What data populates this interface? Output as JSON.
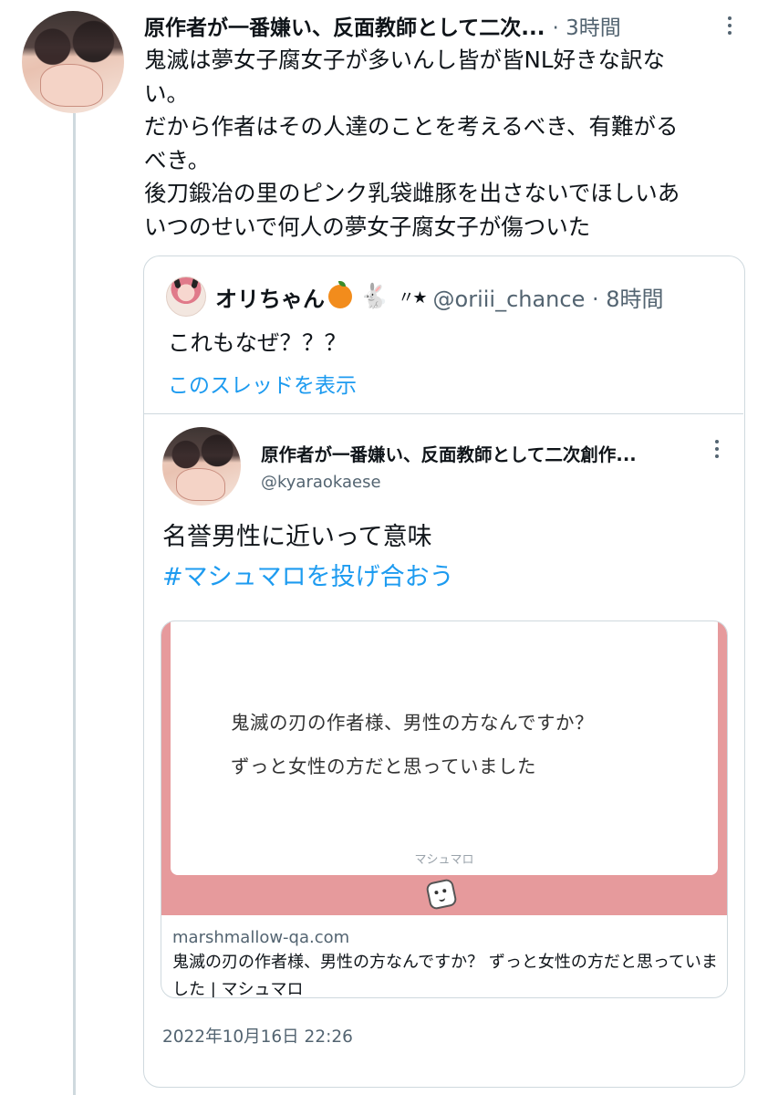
{
  "thread": {
    "author_name": "原作者が一番嫌い、反面教師として二次...",
    "time": "· 3時間",
    "body": "鬼滅は夢女子腐女子が多いんし皆が皆NL好きな訳な\nい。\nだから作者はその人達のことを考えるべき、有難がる\nべき。\n後刀鍛冶の里のピンク乳袋雌豚を出さないでほしいあ\nいつのせいで何人の夢女子腐女子が傷ついた"
  },
  "quote": {
    "author_name": "オリちゃん",
    "emoji_sparkle": "〃★",
    "handle_time": "@oriii_chance · 8時間",
    "text": "これもなぜ？？？",
    "show_thread": "このスレッドを表示",
    "inner": {
      "author_name": "原作者が一番嫌い、反面教師として二次創作...",
      "handle": "@kyaraokaese",
      "text": "名誉男性に近いって意味",
      "hashtag": "#マシュマロを投げ合おう",
      "card": {
        "line1": "鬼滅の刃の作者様、男性の方なんですか？",
        "line2": "ずっと女性の方だと思っていました",
        "brand": "マシュマロ",
        "domain": "marshmallow-qa.com",
        "title": "鬼滅の刃の作者様、男性の方なんですか？ ずっと女性の方だと思っていました | マシュマロ"
      },
      "timestamp": "2022年10月16日 22:26"
    }
  },
  "colors": {
    "link_blue": "#1d9bf0",
    "secondary_text": "#536471",
    "marshmallow_pink": "#e69a9c",
    "border": "#cfd9de"
  },
  "icons": [
    "more-icon",
    "orange-emoji-icon",
    "rabbit-emoji-icon",
    "marshmallow-icon"
  ]
}
